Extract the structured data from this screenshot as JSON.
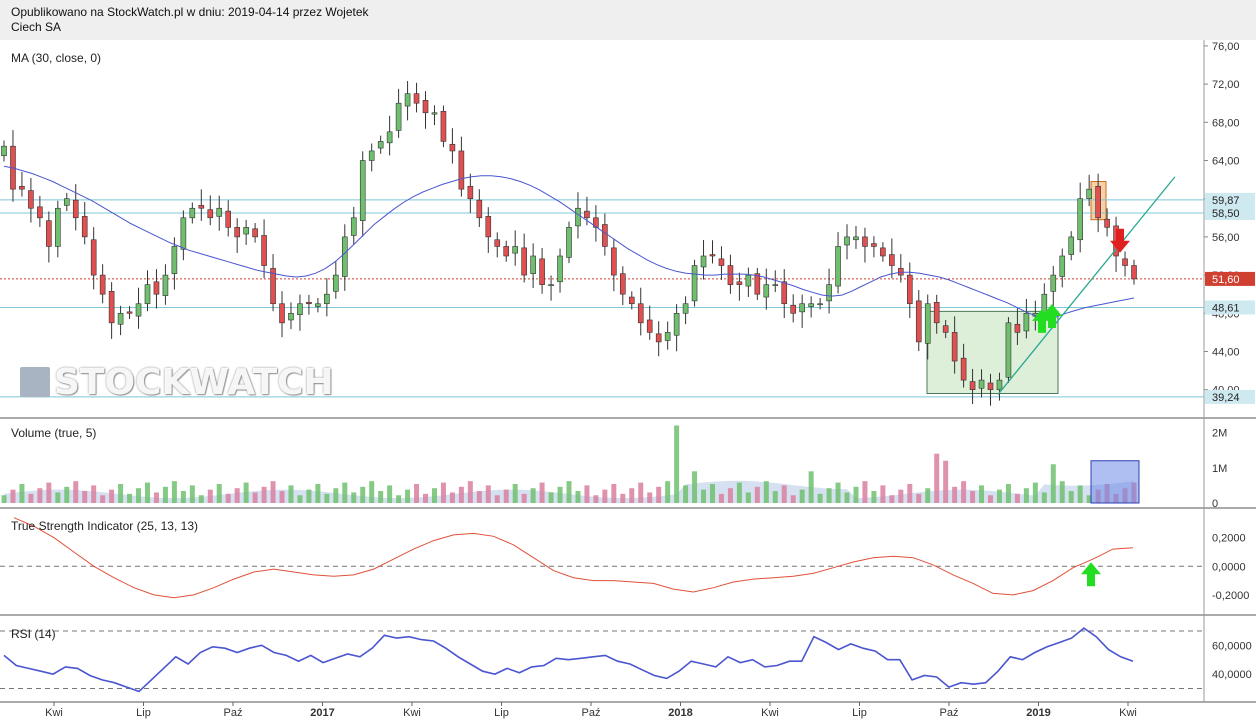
{
  "header": {
    "published": "Opublikowano na StockWatch.pl w dniu: 2019-04-14 przez Wojetek",
    "ticker": "Ciech SA"
  },
  "watermark": "STOCKWATCH",
  "panels": {
    "price": "MA (30, close, 0)",
    "volume": "Volume (true, 5)",
    "tsi": "True Strength Indicator (25, 13, 13)",
    "rsi": "RSI (14)"
  },
  "colors": {
    "up": "#6fbf6f",
    "down": "#e05050",
    "ma": "#4a55d0",
    "tsi": "#e0503a",
    "rsi": "#4a55d0",
    "level": "#7ec8d8",
    "current": "#d04030",
    "box_green": "#cfe8c9",
    "box_orange": "#f7c48e",
    "box_blue": "#6d8ae8"
  },
  "chart_data": [
    {
      "type": "candlestick",
      "title": "MA (30, close, 0)",
      "y_ticks": [
        "76,00",
        "72,00",
        "68,00",
        "64,00",
        "60,00",
        "56,00",
        "52,00",
        "48,00",
        "44,00",
        "40,00"
      ],
      "ylim": [
        38.5,
        76.2
      ],
      "x_ticks": [
        "Kwi",
        "Lip",
        "Paź",
        "2017",
        "Kwi",
        "Lip",
        "Paź",
        "2018",
        "Kwi",
        "Lip",
        "Paź",
        "2019",
        "Kwi"
      ],
      "levels": [
        {
          "label": "59,87",
          "value": 59.87,
          "style": "level"
        },
        {
          "label": "58,50",
          "value": 58.5,
          "style": "level"
        },
        {
          "label": "51,60",
          "value": 51.6,
          "style": "current"
        },
        {
          "label": "48,61",
          "value": 48.61,
          "style": "level"
        },
        {
          "label": "39,24",
          "value": 39.24,
          "style": "level"
        }
      ],
      "closes": [
        65.5,
        61,
        61,
        59,
        58,
        55,
        59,
        60,
        58,
        56,
        52,
        50,
        47,
        48,
        48,
        49,
        51,
        50,
        52,
        55,
        58,
        59,
        59,
        58,
        59,
        57,
        56,
        57,
        56,
        53,
        49,
        47,
        48,
        49,
        49,
        49,
        50,
        52,
        56,
        58,
        64,
        65,
        66,
        67,
        70,
        71,
        70,
        69,
        69,
        66,
        65,
        61,
        60,
        58,
        56,
        55,
        54,
        55,
        52,
        54,
        51,
        51,
        54,
        57,
        59,
        58,
        57,
        55,
        52,
        50,
        49,
        47,
        46,
        45,
        46,
        48,
        49,
        53,
        54,
        54,
        53,
        51,
        51,
        52,
        50,
        51,
        51,
        49,
        48,
        49,
        49,
        49,
        51,
        55,
        56,
        56,
        55,
        55,
        54,
        53,
        52,
        49,
        45,
        49,
        47,
        46,
        43,
        41,
        40,
        41,
        40,
        41,
        47,
        46,
        48,
        48,
        50,
        52,
        54,
        56,
        60,
        61,
        58,
        57,
        54,
        53,
        51.6
      ],
      "ma": [
        63.4,
        63.2,
        62.9,
        62.6,
        62.2,
        61.8,
        61.3,
        60.8,
        60.3,
        59.8,
        59.2,
        58.6,
        58.0,
        57.4,
        56.9,
        56.4,
        55.9,
        55.4,
        55.0,
        54.6,
        54.3,
        54.0,
        53.7,
        53.4,
        53.1,
        52.8,
        52.5,
        52.3,
        52.1,
        51.9,
        51.8,
        51.9,
        52.2,
        52.7,
        53.4,
        54.3,
        55.3,
        56.3,
        57.3,
        58.1,
        58.9,
        59.6,
        60.2,
        60.7,
        61.1,
        61.5,
        61.8,
        62.1,
        62.3,
        62.4,
        62.4,
        62.3,
        62.1,
        61.8,
        61.4,
        60.9,
        60.3,
        59.7,
        59.0,
        58.3,
        57.6,
        56.9,
        56.2,
        55.5,
        54.8,
        54.2,
        53.6,
        53.1,
        52.7,
        52.4,
        52.2,
        52.1,
        52.0,
        52.0,
        52.1,
        52.1,
        52.1,
        52.0,
        51.8,
        51.5,
        51.2,
        50.9,
        50.5,
        50.2,
        49.9,
        49.8,
        49.9,
        50.3,
        50.8,
        51.3,
        51.8,
        52.1,
        52.3,
        52.3,
        52.2,
        52.0,
        51.8,
        51.5,
        51.1,
        50.7,
        50.3,
        49.9,
        49.5,
        49.1,
        48.6,
        48.1,
        47.7,
        47.5,
        47.6,
        48.0,
        48.3,
        48.6,
        48.8,
        49.0,
        49.2,
        49.4,
        49.6
      ]
    },
    {
      "type": "bar",
      "title": "Volume (true, 5)",
      "y_ticks": [
        "2M",
        "1M",
        "0"
      ],
      "ylim": [
        0,
        2300000
      ]
    },
    {
      "type": "line",
      "title": "True Strength Indicator (25, 13, 13)",
      "y_ticks": [
        "0,2000",
        "0,0000",
        "-0,2000"
      ],
      "ylim": [
        -0.32,
        0.38
      ],
      "values": [
        0.34,
        0.28,
        0.2,
        0.1,
        0.0,
        -0.08,
        -0.15,
        -0.2,
        -0.22,
        -0.2,
        -0.15,
        -0.09,
        -0.04,
        -0.02,
        -0.04,
        -0.06,
        -0.07,
        -0.06,
        -0.02,
        0.05,
        0.12,
        0.18,
        0.22,
        0.23,
        0.21,
        0.15,
        0.06,
        -0.03,
        -0.08,
        -0.1,
        -0.1,
        -0.11,
        -0.12,
        -0.16,
        -0.18,
        -0.15,
        -0.11,
        -0.09,
        -0.08,
        -0.07,
        -0.05,
        -0.01,
        0.03,
        0.06,
        0.07,
        0.06,
        0.01,
        -0.06,
        -0.12,
        -0.19,
        -0.2,
        -0.17,
        -0.1,
        -0.01,
        0.05,
        0.12,
        0.13
      ]
    },
    {
      "type": "line",
      "title": "RSI (14)",
      "y_ticks": [
        "60,0000",
        "40,0000"
      ],
      "ylim": [
        22,
        79
      ],
      "values": [
        53,
        46,
        44,
        42,
        40,
        45,
        44,
        39,
        36,
        34,
        31,
        28,
        36,
        44,
        52,
        47,
        55,
        59,
        58,
        55,
        58,
        60,
        55,
        53,
        49,
        53,
        48,
        51,
        54,
        52,
        58,
        67,
        65,
        66,
        64,
        63,
        58,
        52,
        47,
        42,
        40,
        44,
        41,
        45,
        46,
        51,
        50,
        51,
        52,
        53,
        49,
        47,
        43,
        39,
        37,
        42,
        49,
        47,
        45,
        52,
        48,
        50,
        45,
        46,
        49,
        49,
        66,
        62,
        57,
        61,
        58,
        56,
        50,
        50,
        36,
        39,
        38,
        31,
        34,
        33,
        34,
        42,
        52,
        50,
        55,
        59,
        62,
        65,
        72,
        66,
        57,
        52,
        49
      ],
      "levels": [
        70,
        30
      ]
    }
  ]
}
